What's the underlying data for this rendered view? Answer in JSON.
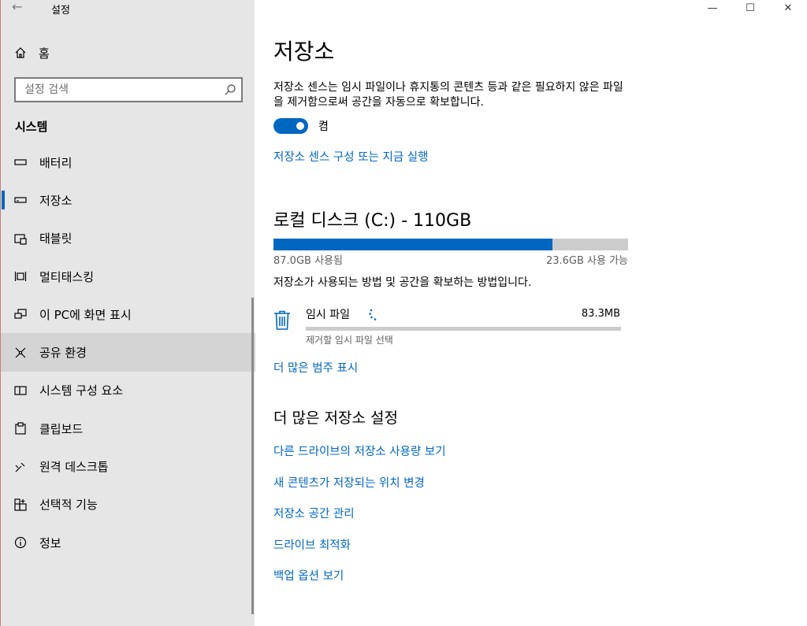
{
  "window": {
    "title": "설정",
    "back_glyph": "←",
    "minimize_glyph": "—",
    "maximize_glyph": "☐",
    "close_glyph": "✕"
  },
  "sidebar": {
    "home_label": "홈",
    "search_placeholder": "설정 검색",
    "section_label": "시스템",
    "items": [
      {
        "label": "배터리",
        "icon": "battery-icon"
      },
      {
        "label": "저장소",
        "icon": "storage-icon",
        "selected": true
      },
      {
        "label": "태블릿",
        "icon": "tablet-icon"
      },
      {
        "label": "멀티태스킹",
        "icon": "multitasking-icon"
      },
      {
        "label": "이 PC에 화면 표시",
        "icon": "project-icon"
      },
      {
        "label": "공유 환경",
        "icon": "shared-experiences-icon",
        "hovered": true
      },
      {
        "label": "시스템 구성 요소",
        "icon": "components-icon"
      },
      {
        "label": "클립보드",
        "icon": "clipboard-icon"
      },
      {
        "label": "원격 데스크톱",
        "icon": "remote-desktop-icon"
      },
      {
        "label": "선택적 기능",
        "icon": "optional-features-icon"
      },
      {
        "label": "정보",
        "icon": "info-icon"
      }
    ]
  },
  "main": {
    "title": "저장소",
    "description": "저장소 센스는 임시 파일이나 휴지통의 콘텐츠 등과 같은 필요하지 않은 파일을 제거함으로써 공간을 자동으로 확보합니다.",
    "toggle_label": "켬",
    "toggle_on": true,
    "sense_link": "저장소 센스 구성 또는 지금 실행",
    "drive": {
      "title": "로컬 디스크 (C:) - 110GB",
      "used_label": "87.0GB 사용됨",
      "free_label": "23.6GB 사용 가능",
      "used_fraction": 0.786
    },
    "usage_description": "저장소가 사용되는 방법 및 공간을 확보하는 방법입니다.",
    "category": {
      "name": "임시 파일",
      "size": "83.3MB",
      "subtitle": "제거할 임시 파일 선택",
      "fraction": 0.0
    },
    "more_categories_link": "더 많은 범주 표시",
    "more_settings_title": "더 많은 저장소 설정",
    "more_links": [
      "다른 드라이브의 저장소 사용량 보기",
      "새 콘텐츠가 저장되는 위치 변경",
      "저장소 공간 관리",
      "드라이브 최적화",
      "백업 옵션 보기"
    ],
    "accent_color": "#0067c0"
  }
}
